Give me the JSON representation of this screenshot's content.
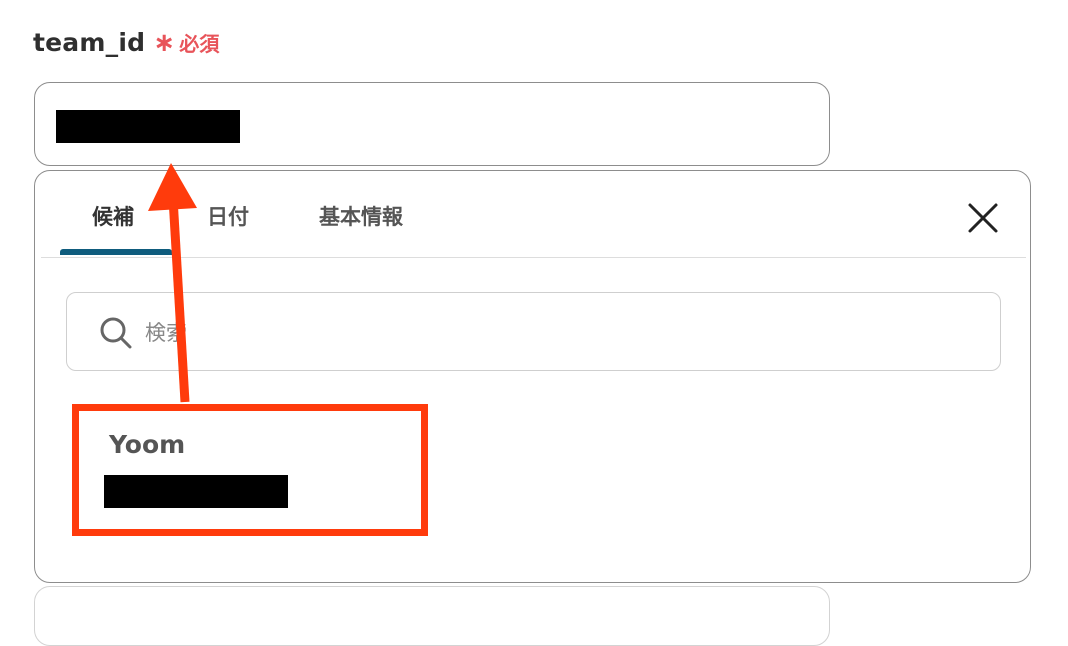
{
  "field": {
    "label": "team_id",
    "required_mark": "∗",
    "required_text": "必須"
  },
  "popup": {
    "tabs": [
      {
        "label": "候補",
        "active": true
      },
      {
        "label": "日付",
        "active": false
      },
      {
        "label": "基本情報",
        "active": false
      }
    ],
    "close_icon": "close-icon",
    "search": {
      "placeholder": "検索",
      "value": "",
      "icon": "search-icon"
    },
    "candidate": {
      "title": "Yoom",
      "highlight_color": "#ff3b0c"
    }
  },
  "colors": {
    "accent": "#0f5c7d",
    "required": "#e8545a",
    "annotation": "#ff3b0c"
  }
}
